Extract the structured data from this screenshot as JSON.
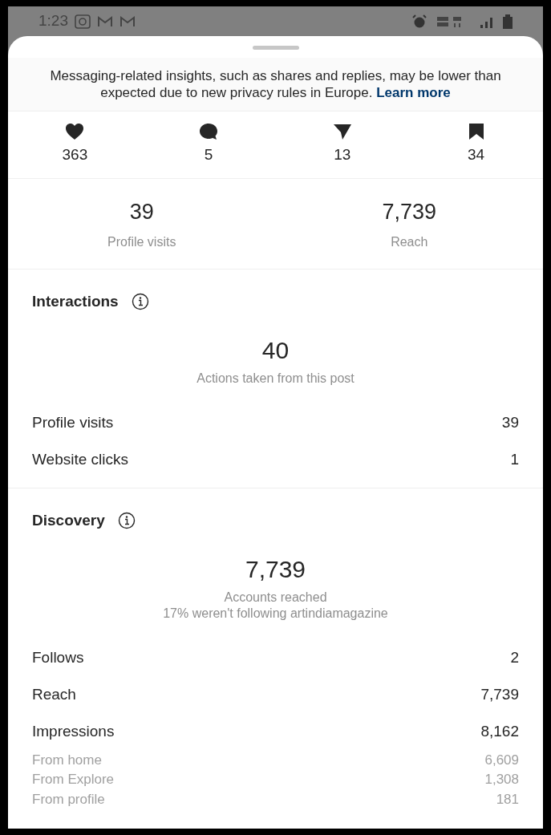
{
  "status_bar": {
    "time": "1:23"
  },
  "banner": {
    "text": "Messaging-related insights, such as shares and replies, may be lower than expected due to new privacy rules in Europe.",
    "link": "Learn more"
  },
  "engagement": [
    {
      "kind": "likes",
      "count": "363"
    },
    {
      "kind": "comments",
      "count": "5"
    },
    {
      "kind": "shares",
      "count": "13"
    },
    {
      "kind": "saves",
      "count": "34"
    }
  ],
  "summary": [
    {
      "value": "39",
      "label": "Profile visits"
    },
    {
      "value": "7,739",
      "label": "Reach"
    }
  ],
  "interactions": {
    "title": "Interactions",
    "total": "40",
    "total_label": "Actions taken from this post",
    "rows": [
      {
        "kind": "main",
        "label": "Profile visits",
        "value": "39"
      },
      {
        "kind": "main",
        "label": "Website clicks",
        "value": "1"
      }
    ]
  },
  "discovery": {
    "title": "Discovery",
    "total": "7,739",
    "total_label": "Accounts reached",
    "note": "17% weren't following artindiamagazine",
    "rows": [
      {
        "kind": "main",
        "label": "Follows",
        "value": "2"
      },
      {
        "kind": "main",
        "label": "Reach",
        "value": "7,739"
      },
      {
        "kind": "main",
        "label": "Impressions",
        "value": "8,162"
      },
      {
        "kind": "sub",
        "label": "From home",
        "value": "6,609"
      },
      {
        "kind": "sub",
        "label": "From Explore",
        "value": "1,308"
      },
      {
        "kind": "sub",
        "label": "From profile",
        "value": "181"
      }
    ]
  }
}
